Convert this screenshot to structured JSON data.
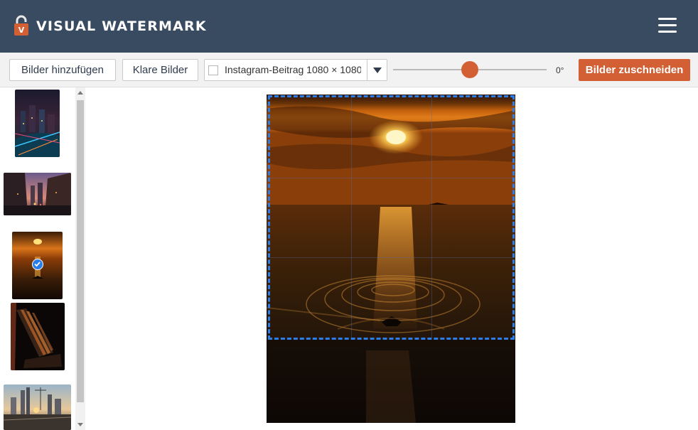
{
  "header": {
    "title": "VISUAL WATERMARK",
    "logo_letter": "V"
  },
  "toolbar": {
    "add_images_label": "Bilder hinzufügen",
    "clear_images_label": "Klare Bilder",
    "preset_select": {
      "value": "Instagram-Beitrag 1080 × 1080",
      "checked": false
    },
    "rotation_slider": {
      "value_deg": 0,
      "fraction": 0.5
    },
    "angle_label": "0°",
    "crop_button_label": "Bilder zuschneiden"
  },
  "sidebar": {
    "thumbnails": [
      {
        "subject": "city-night-aerial",
        "selected": false
      },
      {
        "subject": "street-dusk",
        "selected": false
      },
      {
        "subject": "sunset-sea-boat",
        "selected": true
      },
      {
        "subject": "dark-interior-shadows",
        "selected": false
      },
      {
        "subject": "city-skyline-sunset",
        "selected": false
      }
    ]
  },
  "colors": {
    "header_bg": "#394b61",
    "accent": "#d35f35",
    "crop_border": "#2b7de9",
    "toolbar_bg": "#f2f2f2"
  }
}
